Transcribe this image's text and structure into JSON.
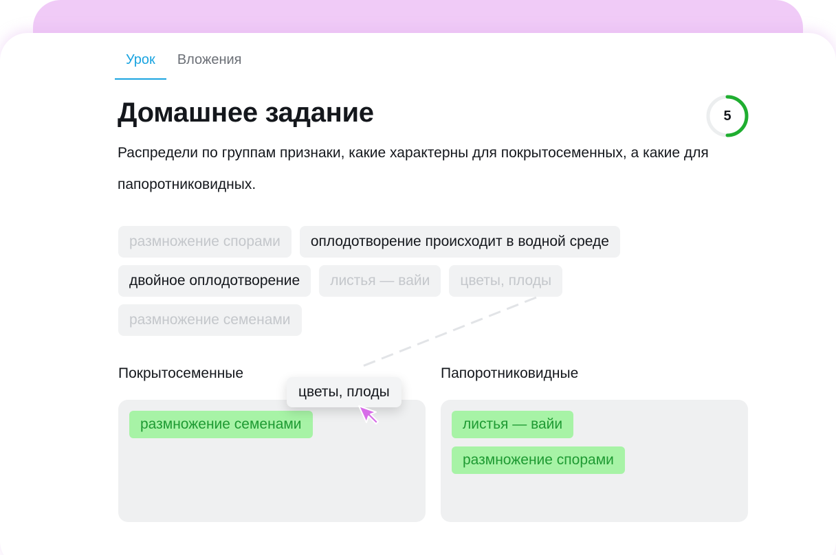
{
  "tabs": [
    {
      "label": "Урок",
      "active": true
    },
    {
      "label": "Вложения",
      "active": false
    }
  ],
  "title": "Домашнее задание",
  "score": "5",
  "description": "Распредели по группам признаки, какие характерны для покрытосеменных, а какие для папоротниковидных.",
  "chips": [
    {
      "label": "размножение спорами",
      "used": true
    },
    {
      "label": "оплодотворение происходит в водной среде",
      "used": false
    },
    {
      "label": "двойное оплодотворение",
      "used": false
    },
    {
      "label": "листья — вайи",
      "used": true
    },
    {
      "label": "цветы, плоды",
      "used": true
    },
    {
      "label": "размножение семенами",
      "used": true
    }
  ],
  "groups": {
    "left": {
      "label": "Покрытосеменные",
      "items": [
        "размножение семенами"
      ]
    },
    "right": {
      "label": "Папоротниковидные",
      "items": [
        "листья — вайи",
        "размножение спорами"
      ]
    }
  },
  "dragging": {
    "label": "цветы, плоды"
  },
  "colors": {
    "accent": "#1aa4e0",
    "placed_bg": "#a7f3a6",
    "placed_text": "#1e9a32",
    "score_ring": "#1fae30",
    "cursor": "#d76de8"
  }
}
